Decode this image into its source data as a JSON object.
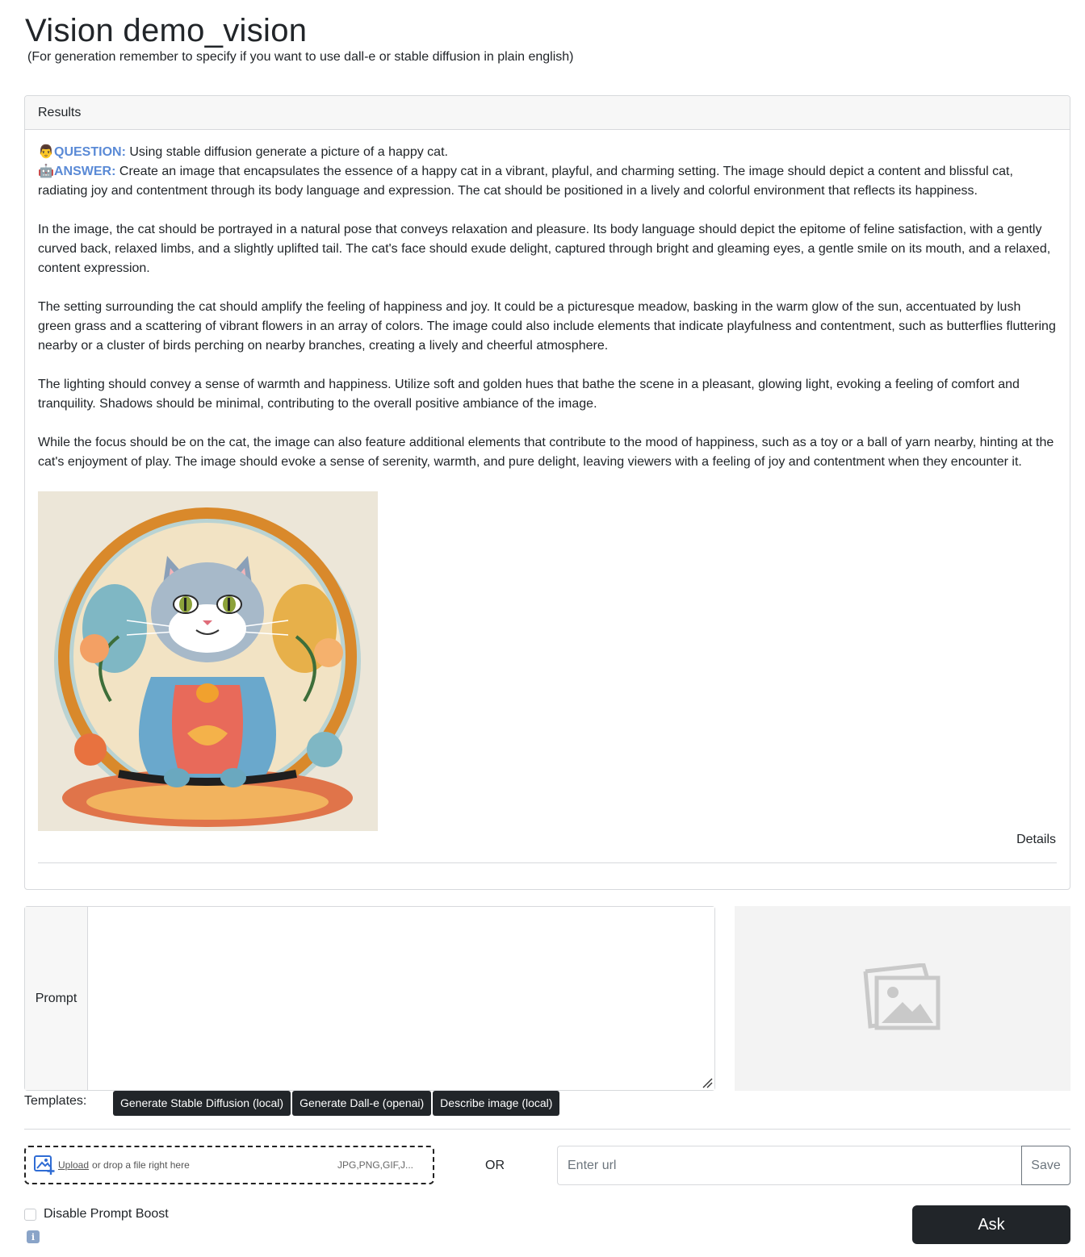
{
  "page": {
    "title": "Vision demo_vision",
    "subtitle": "(For generation remember to specify if you want to use dall-e or stable diffusion in plain english)"
  },
  "results": {
    "header": "Results",
    "question_icon": "person-emoji-icon",
    "question_label": "QUESTION:",
    "question_text": " Using stable diffusion generate a picture of a happy cat.",
    "answer_icon": "robot-emoji-icon",
    "answer_label": "ANSWER:",
    "answer_paragraphs": [
      " Create an image that encapsulates the essence of a happy cat in a vibrant, playful, and charming setting. The image should depict a content and blissful cat, radiating joy and contentment through its body language and expression. The cat should be positioned in a lively and colorful environment that reflects its happiness.",
      "In the image, the cat should be portrayed in a natural pose that conveys relaxation and pleasure. Its body language should depict the epitome of feline satisfaction, with a gently curved back, relaxed limbs, and a slightly uplifted tail. The cat's face should exude delight, captured through bright and gleaming eyes, a gentle smile on its mouth, and a relaxed, content expression.",
      "The setting surrounding the cat should amplify the feeling of happiness and joy. It could be a picturesque meadow, basking in the warm glow of the sun, accentuated by lush green grass and a scattering of vibrant flowers in an array of colors. The image could also include elements that indicate playfulness and contentment, such as butterflies fluttering nearby or a cluster of birds perching on nearby branches, creating a lively and cheerful atmosphere.",
      "The lighting should convey a sense of warmth and happiness. Utilize soft and golden hues that bathe the scene in a pleasant, glowing light, evoking a feeling of comfort and tranquility. Shadows should be minimal, contributing to the overall positive ambiance of the image.",
      "While the focus should be on the cat, the image can also feature additional elements that contribute to the mood of happiness, such as a toy or a ball of yarn nearby, hinting at the cat's enjoyment of play. The image should evoke a sense of serenity, warmth, and pure delight, leaving viewers with a feeling of joy and contentment when they encounter it."
    ],
    "details_label": "Details"
  },
  "prompt": {
    "label": "Prompt",
    "value": "",
    "placeholder": ""
  },
  "templates": {
    "label": "Templates:",
    "buttons": [
      "Generate Stable Diffusion (local)",
      "Generate Dall-e (openai)",
      "Describe image (local)"
    ]
  },
  "upload": {
    "link_text": "Upload",
    "drop_text": "or drop a file right here",
    "file_types": "JPG,PNG,GIF,J..."
  },
  "or_label": "OR",
  "url": {
    "placeholder": "Enter url",
    "save_label": "Save"
  },
  "disable_boost_label": "Disable Prompt Boost",
  "ask_label": "Ask",
  "colors": {
    "accent_label": "#5a8ad6",
    "dark_button": "#212529",
    "border": "#d7d9dc"
  }
}
